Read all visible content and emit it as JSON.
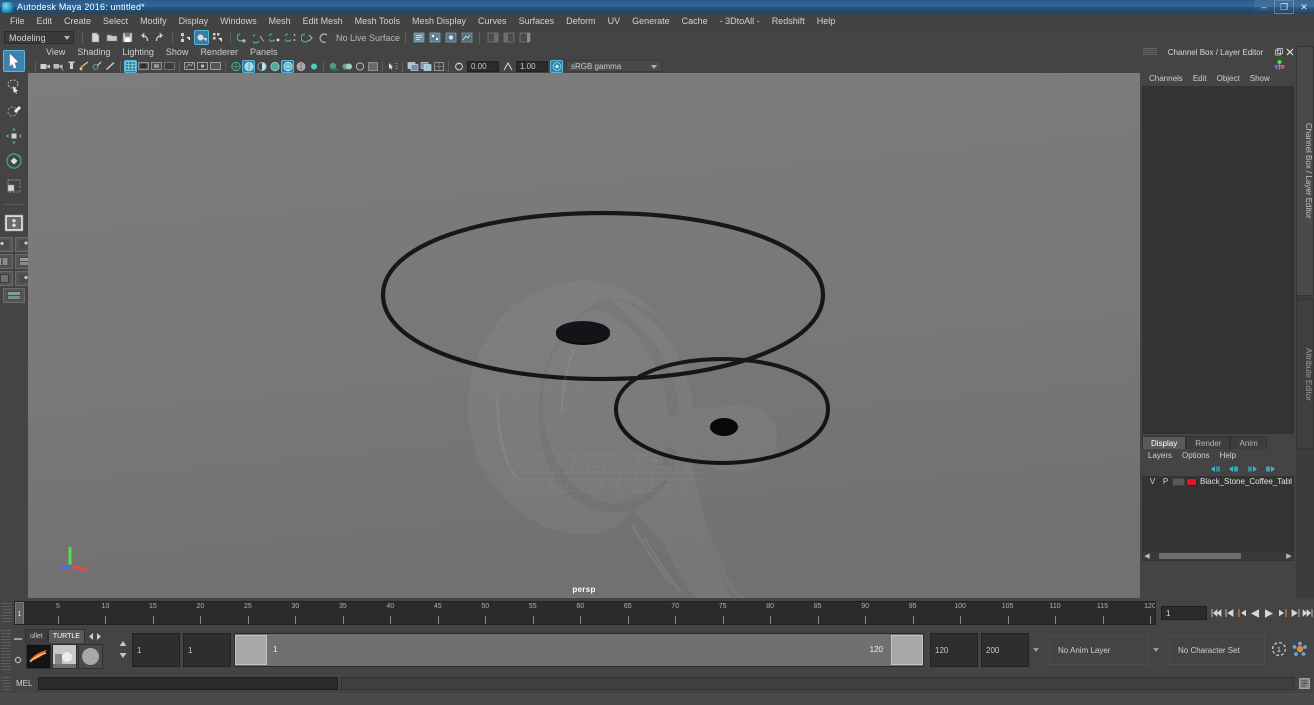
{
  "window": {
    "title": "Autodesk Maya 2016: untitled*",
    "app_icon": "maya-icon",
    "minimize": "–",
    "restore": "❐",
    "close": "✕"
  },
  "menubar": {
    "items": [
      {
        "label": "File"
      },
      {
        "label": "Edit"
      },
      {
        "label": "Create"
      },
      {
        "label": "Select"
      },
      {
        "label": "Modify"
      },
      {
        "label": "Display"
      },
      {
        "label": "Windows"
      },
      {
        "label": "Mesh"
      },
      {
        "label": "Edit Mesh"
      },
      {
        "label": "Mesh Tools"
      },
      {
        "label": "Mesh Display"
      },
      {
        "label": "Curves"
      },
      {
        "label": "Surfaces"
      },
      {
        "label": "Deform"
      },
      {
        "label": "UV"
      },
      {
        "label": "Generate"
      },
      {
        "label": "Cache"
      },
      {
        "label": "- 3DtoAll -"
      },
      {
        "label": "Redshift"
      },
      {
        "label": "Help"
      }
    ]
  },
  "statusline": {
    "menu_set": "Modeling",
    "live_surface": "No Live Surface",
    "file_buttons": [
      "new-scene-icon",
      "open-scene-icon",
      "save-scene-icon",
      "undo-icon",
      "redo-icon"
    ],
    "select_modes": [
      "select-by-hierarchy-icon",
      "select-by-object-icon",
      "select-by-component-icon"
    ],
    "snap_buttons": [
      "snap-to-grid-icon",
      "snap-to-curve-icon",
      "snap-to-point-icon",
      "snap-to-projected-center-icon",
      "snap-to-view-plane-icon",
      "make-live-icon"
    ]
  },
  "toolbox": {
    "tools": [
      {
        "name": "select-tool",
        "selected": true
      },
      {
        "name": "lasso-select-tool",
        "selected": false
      },
      {
        "name": "paint-select-tool",
        "selected": false
      },
      {
        "name": "move-tool",
        "selected": false
      },
      {
        "name": "rotate-tool",
        "selected": false
      },
      {
        "name": "scale-tool",
        "selected": false
      }
    ],
    "last_tool": "last-tool-used",
    "layouts": [
      "single-perspective-layout",
      "four-view-layout",
      "two-pane-side-layout",
      "outliner-persp-layout",
      "hypergraph-persp-layout",
      "persp-graph-layout",
      "outliner-graph-layout"
    ]
  },
  "viewport": {
    "panel_menus": [
      "View",
      "Shading",
      "Lighting",
      "Show",
      "Renderer",
      "Panels"
    ],
    "camera_label": "persp",
    "exposure": "0.00",
    "gamma": "1.00",
    "color_management": "sRGB gamma",
    "background_color": "#7a7a7a",
    "model_color": "#46505a",
    "toolbar_icons": [
      "select-camera-icon",
      "lock-camera-icon",
      "camera-attributes-icon",
      "bookmark-icon",
      "image-plane-icon",
      "two-d-pan-zoom-icon",
      "grid-toggle-icon",
      "film-gate-icon",
      "resolution-gate-icon",
      "gate-mask-icon",
      "xray-icon",
      "xray-joints-icon",
      "xray-active-components-icon",
      "wireframe-shading-icon",
      "smooth-shade-all-icon",
      "smooth-shade-selected-icon",
      "flat-shade-icon",
      "shaded-wireframe-icon",
      "shaded-textured-icon",
      "use-default-light-icon",
      "shadows-icon",
      "screen-space-ao-icon",
      "motion-blur-icon",
      "multisample-icon",
      "isolate-select-icon",
      "viewport-panel-one-icon",
      "viewport-panel-two-icon",
      "grid-snap-icon",
      "exposure-icon",
      "gamma-icon",
      "color-management-icon"
    ]
  },
  "channel_box": {
    "title": "Channel Box / Layer Editor",
    "float_icon": "undock-icon",
    "close_icon": "close-icon",
    "menus": [
      "Channels",
      "Edit",
      "Object",
      "Show"
    ]
  },
  "layer_editor": {
    "tabs": [
      {
        "label": "Display",
        "active": true
      },
      {
        "label": "Render",
        "active": false
      },
      {
        "label": "Anim",
        "active": false
      }
    ],
    "menus": [
      "Layers",
      "Options",
      "Help"
    ],
    "toolbar_icons": [
      "new-layer-icon",
      "new-layer-from-selected-icon",
      "move-layer-up-icon",
      "move-layer-down-icon"
    ],
    "columns": [
      "V",
      "P"
    ],
    "layers": [
      {
        "visible": "V",
        "playback": "P",
        "color": "#e1142c",
        "name": "Black_Stone_Coffee_Tabl"
      }
    ]
  },
  "vertical_tabs": [
    {
      "label": "Channel Box / Layer Editor",
      "active": true
    },
    {
      "label": "Attribute Editor",
      "active": false
    }
  ],
  "time_slider": {
    "current_frame": "1",
    "start": 1,
    "end": 120,
    "tick_labels": [
      "5",
      "10",
      "15",
      "20",
      "25",
      "30",
      "35",
      "40",
      "45",
      "50",
      "55",
      "60",
      "65",
      "70",
      "75",
      "80",
      "85",
      "90",
      "95",
      "100",
      "105",
      "110",
      "115",
      "120"
    ],
    "playback_buttons": [
      "go-to-start-icon",
      "step-back-frame-icon",
      "step-back-key-icon",
      "play-backwards-icon",
      "play-forwards-icon",
      "step-forward-key-icon",
      "step-forward-frame-icon",
      "go-to-end-icon"
    ]
  },
  "range_slider": {
    "shelf_tabs": [
      {
        "label": "ullet",
        "active": false
      },
      {
        "label": "TURTLE",
        "active": true
      }
    ],
    "shelf_items": [
      "turtle-render-icon",
      "turtle-bake-icon",
      "turtle-sphere-icon"
    ],
    "anim_start": "1",
    "range_start": "1",
    "slider_start_label": "1",
    "slider_end_label": "120",
    "range_end": "120",
    "anim_end": "200",
    "anim_layer": "No Anim Layer",
    "character_set": "No Character Set",
    "auto_keyframe_icon": "auto-keyframe-icon",
    "animation_prefs_icon": "animation-preferences-icon"
  },
  "command_line": {
    "label": "MEL",
    "input_value": "",
    "output_value": ""
  }
}
